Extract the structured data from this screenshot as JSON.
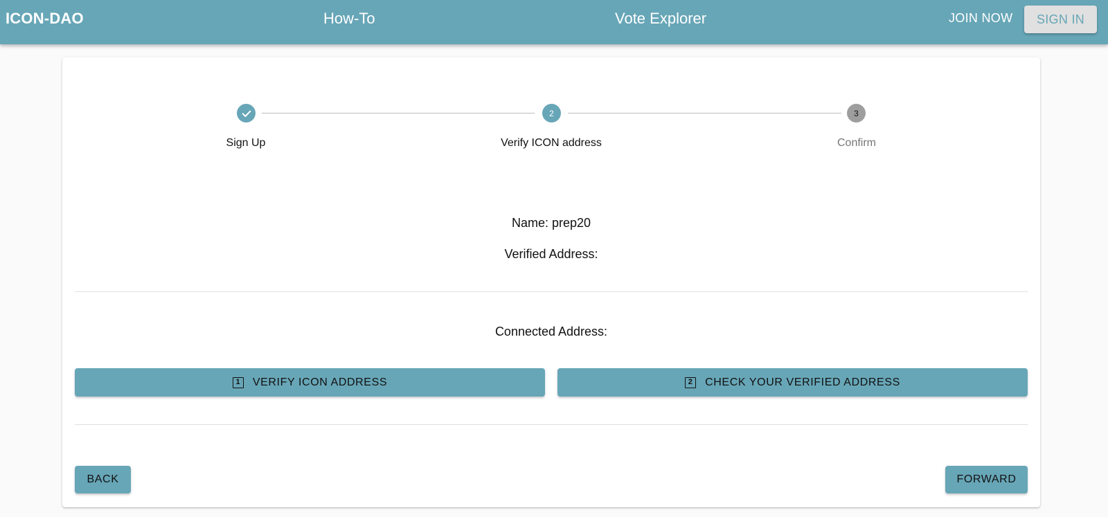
{
  "header": {
    "brand": "ICON-DAO",
    "nav": [
      {
        "label": "How-To"
      },
      {
        "label": "Vote Explorer"
      }
    ],
    "join_label": "JOIN NOW",
    "signin_label": "SIGN IN"
  },
  "stepper": {
    "steps": [
      {
        "label": "Sign Up",
        "index": "1",
        "state": "completed",
        "icon": "check-icon"
      },
      {
        "label": "Verify ICON address",
        "index": "2",
        "state": "active"
      },
      {
        "label": "Confirm",
        "index": "3",
        "state": "inactive"
      }
    ]
  },
  "info": {
    "name": "Name: prep20",
    "verified_address": "Verified Address:",
    "connected_address": "Connected Address:"
  },
  "actions": {
    "verify_label": "VERIFY ICON ADDRESS",
    "verify_icon_number": "1",
    "check_label": "CHECK YOUR VERIFIED ADDRESS",
    "check_icon_number": "2"
  },
  "navigation": {
    "back_label": "BACK",
    "forward_label": "FORWARD"
  },
  "colors": {
    "primary": "#67a6b7",
    "inactive_step": "#9e9e9e",
    "background": "#fafafa"
  }
}
